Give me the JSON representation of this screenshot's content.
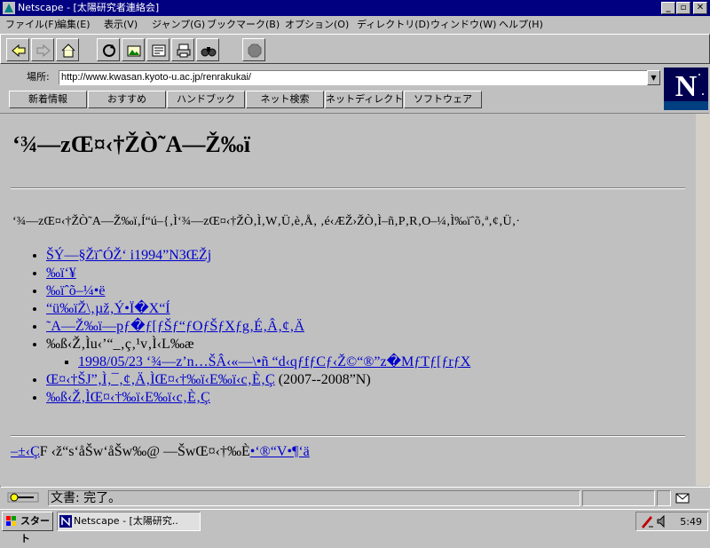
{
  "window": {
    "title": "Netscape - [太陽研究者連絡会]",
    "minimize": "_",
    "maximize": "▫",
    "close": "✕"
  },
  "menu": [
    "ファイル(F)",
    "編集(E)",
    "表示(V)",
    "ジャンプ(G)",
    "ブックマーク(B)",
    "オプション(O)",
    "ディレクトリ(D)",
    "ウィンドウ(W)",
    "ヘルプ(H)"
  ],
  "toolbar_icons": [
    "back-icon",
    "forward-icon",
    "home-icon",
    "reload-icon",
    "images-icon",
    "open-icon",
    "print-icon",
    "find-icon",
    "stop-icon"
  ],
  "location": {
    "label": "場所:",
    "url": "http://www.kwasan.kyoto-u.ac.jp/renrakukai/"
  },
  "directory_buttons": [
    "新着情報",
    "おすすめ",
    "ハンドブック",
    "ネット検索",
    "ネットディレクトリ",
    "ソフトウェア"
  ],
  "logo_letter": "N",
  "page": {
    "heading": "‘¾—zŒ¤‹†ŽÒ˜A—Ž‰ï",
    "intro": "‘¾—zŒ¤‹†ŽÒ˜A—Ž‰ï‚Í“ú–{‚Ì‘¾—zŒ¤‹†ŽÒ‚Ì‚W‚Ü‚è‚Å‚ ‚é‹ÆŽ›ŽÒ‚Ì–ñ‚P‚R‚O–¼‚Ì‰ïˆõ‚ª‚¢‚Ü‚·",
    "links": [
      "ŠÝ—§ŽïˆÓŽ‘ i1994”N3ŒŽj",
      "‰ï‘¥",
      "‰ïˆõ–¼•ë",
      "“ü‰ïŽ\\‚µž‚Ý•Ï�X“Í",
      "˜A—Ž‰ï—pƒ�ƒ[ƒŠƒ“ƒOƒŠƒXƒg‚É‚Â‚¢‚Ä"
    ],
    "info_item": "‰ß‹Ž‚Ìu‹’“_‚ç‚¹v‚Ì‹L‰æ",
    "sub_link": "1998/05/23 ‘¾—z’n…ŠÂ‹«—\\•ñ “d‹qƒfƒCƒ‹Ž©“®”z�MƒTƒ[ƒrƒX",
    "link_with_note": "Œ¤‹†ŠJ”­‚Ì‚¯‚¢‚Ä‚ÌŒ¤‹†‰ï‹E‰ï‹c‚È‚Ç",
    "link_note": "(2007--2008”N)",
    "last_link": "‰ß‹Ž‚ÌŒ¤‹†‰ï‹E‰ï‹c‚È‚Ç",
    "footer_link1": "–±‹Ç",
    "footer_text": "F ‹ž“s‘åŠw‘åŠw‰@ —ŠwŒ¤‹†‰È",
    "footer_link2": "•‘®“V•¶‘ä"
  },
  "status": {
    "text": "文書: 完了。"
  },
  "taskbar": {
    "start": "スタート",
    "task": "Netscape - [太陽研究..",
    "time": "5:49"
  }
}
